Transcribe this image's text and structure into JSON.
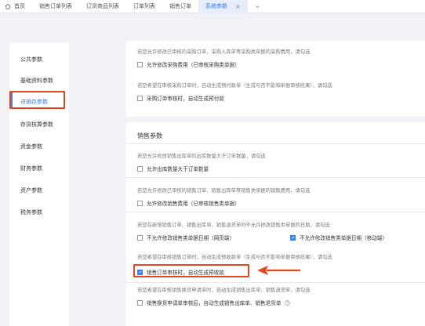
{
  "tabs": [
    {
      "label": "首页",
      "icon": "home-icon"
    },
    {
      "label": "销售订单列表"
    },
    {
      "label": "订货商品列表"
    },
    {
      "label": "订单列表"
    },
    {
      "label": "销售订单"
    },
    {
      "label": "系统参数",
      "active": true,
      "close": "×"
    }
  ],
  "sidebar": {
    "items": [
      {
        "label": "公共参数"
      },
      {
        "label": "基础资料参数"
      },
      {
        "label": "进销存参数",
        "active": true
      },
      {
        "label": "存货核算参数"
      },
      {
        "label": "资金参数"
      },
      {
        "label": "财务参数"
      },
      {
        "label": "资产参数"
      },
      {
        "label": "税务参数"
      }
    ]
  },
  "purchase": {
    "desc1": "若您允许修改已审核的采购订单、采购入库单等采购类单据的采购费用，请勾选",
    "opt1": "允许修改采购费用（已审核采购类单据）",
    "desc2": "若您希望在审核采购订单时，自动生成预付款单（生成与否不影响单据审核结果），请勾选",
    "opt2": "采购订单审核时，自动生成预付款"
  },
  "sales": {
    "title": "销售参数",
    "desc1": "若您允许修改销售出库单的出库数量大于订单数量，请勾选",
    "opt1": "允许出库数量大于订单数量",
    "desc2": "若您允许修改已审核的销售订单、销售出库单等销售类单据的销售费用，请勾选",
    "opt2": "允许修改销售费用（已审核销售类单据）",
    "desc3": "若您在新增销售订单、销售出库单、销售退货单时不允许修改销售类单据的日期，请勾选",
    "opt3a": "不允许修改销售类单据日期（网页端）",
    "opt3b": "不允许修改销售类单据日期（移动端）",
    "desc4": "若您希望在审核销售订单时，自动生成预收款单（生成与否不影响单据审核结果），请勾选",
    "opt4": "销售订单审核时，自动生成预收款",
    "desc5": "若您希望在审核销售换货申请单时，自动生成销售出库单、销售退货单，请勾选",
    "opt5": "销售换货申请单审核后，自动生成销售出库单、销售退货单"
  },
  "colors": {
    "accent": "#3b7ded",
    "highlight": "#e5461a"
  }
}
